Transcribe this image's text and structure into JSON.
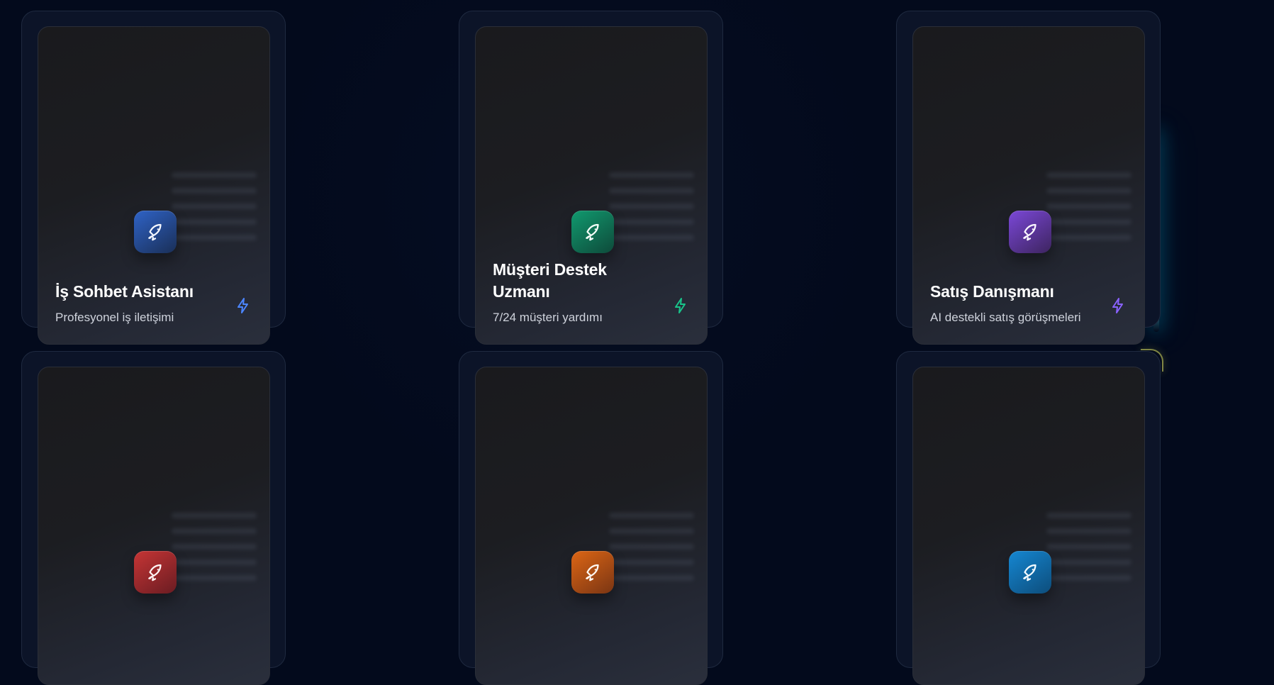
{
  "cards": [
    {
      "title": "İş Sohbet Asistanı",
      "subtitle": "Profesyonel iş iletişimi",
      "icon": "rocket-icon",
      "icon_gradient": [
        "#2f63c7",
        "#1a2f57"
      ],
      "accent_color": "#4c86ff"
    },
    {
      "title": "Müşteri Destek Uzmanı",
      "subtitle": "7/24 müşteri yardımı",
      "icon": "rocket-icon",
      "icon_gradient": [
        "#119a6f",
        "#0e4a3a"
      ],
      "accent_color": "#19c48a"
    },
    {
      "title": "Satış Danışmanı",
      "subtitle": "AI destekli satış görüşmeleri",
      "icon": "rocket-icon",
      "icon_gradient": [
        "#7b48d8",
        "#3d245f"
      ],
      "accent_color": "#8a62ff"
    },
    {
      "title": "",
      "subtitle": "",
      "icon": "rocket-icon",
      "icon_gradient": [
        "#c63535",
        "#6a1c22"
      ],
      "accent_color": "#ff4c4c"
    },
    {
      "title": "",
      "subtitle": "",
      "icon": "rocket-icon",
      "icon_gradient": [
        "#dd6615",
        "#7a3513"
      ],
      "accent_color": "#ff8b2a"
    },
    {
      "title": "",
      "subtitle": "",
      "icon": "rocket-icon",
      "icon_gradient": [
        "#1587d2",
        "#0d4d7b"
      ],
      "accent_color": "#2bb7ff"
    }
  ]
}
